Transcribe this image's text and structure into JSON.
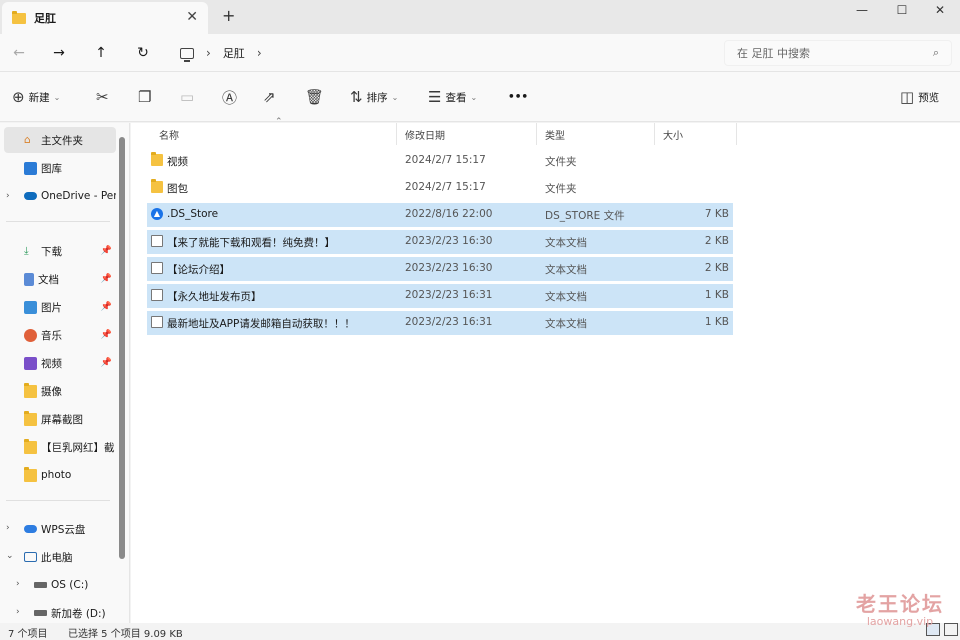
{
  "window": {
    "tab_title": "足肛",
    "tab_close": "✕",
    "tab_add": "+",
    "minimize": "—",
    "maximize": "☐",
    "close": "✕"
  },
  "address": {
    "crumb": "足肛",
    "search_placeholder": "在 足肛 中搜索"
  },
  "toolbar": {
    "new_label": "新建",
    "sort_label": "排序",
    "view_label": "查看",
    "more_label": "•••",
    "preview_label": "预览"
  },
  "sidebar": {
    "items": [
      {
        "label": "主文件夹",
        "icon": "home-icon"
      },
      {
        "label": "图库",
        "icon": "gallery-icon"
      },
      {
        "label": "OneDrive - Per",
        "icon": "cloud-icon"
      },
      {
        "label": "下载",
        "icon": "download-icon"
      },
      {
        "label": "文档",
        "icon": "document-icon"
      },
      {
        "label": "图片",
        "icon": "picture-icon"
      },
      {
        "label": "音乐",
        "icon": "music-icon"
      },
      {
        "label": "视频",
        "icon": "video-icon"
      },
      {
        "label": "摄像",
        "icon": "folder-icon"
      },
      {
        "label": "屏幕截图",
        "icon": "folder-icon"
      },
      {
        "label": "【巨乳网红】截",
        "icon": "folder-icon"
      },
      {
        "label": "photo",
        "icon": "folder-icon"
      },
      {
        "label": "WPS云盘",
        "icon": "wps-cloud-icon"
      },
      {
        "label": "此电脑",
        "icon": "pc-icon"
      },
      {
        "label": "OS (C:)",
        "icon": "drive-icon"
      },
      {
        "label": "新加卷 (D:)",
        "icon": "drive-icon"
      }
    ]
  },
  "columns": {
    "name": "名称",
    "modified": "修改日期",
    "type": "类型",
    "size": "大小"
  },
  "files": [
    {
      "name": "视频",
      "date": "2024/2/7 15:17",
      "type": "文件夹",
      "size": "",
      "icon": "folder-icon",
      "selected": false
    },
    {
      "name": "图包",
      "date": "2024/2/7 15:17",
      "type": "文件夹",
      "size": "",
      "icon": "folder-icon",
      "selected": false
    },
    {
      "name": ".DS_Store",
      "date": "2022/8/16 22:00",
      "type": "DS_STORE 文件",
      "size": "7 KB",
      "icon": "app-file-icon",
      "selected": true
    },
    {
      "name": "【来了就能下载和观看！纯免费！】",
      "date": "2023/2/23 16:30",
      "type": "文本文档",
      "size": "2 KB",
      "icon": "text-file-icon",
      "selected": true
    },
    {
      "name": "【论坛介绍】",
      "date": "2023/2/23 16:30",
      "type": "文本文档",
      "size": "2 KB",
      "icon": "text-file-icon",
      "selected": true
    },
    {
      "name": "【永久地址发布页】",
      "date": "2023/2/23 16:31",
      "type": "文本文档",
      "size": "1 KB",
      "icon": "text-file-icon",
      "selected": true
    },
    {
      "name": "最新地址及APP请发邮箱自动获取！！！",
      "date": "2023/2/23 16:31",
      "type": "文本文档",
      "size": "1 KB",
      "icon": "text-file-icon",
      "selected": true
    }
  ],
  "status": {
    "count": "7 个项目",
    "selection": "已选择 5 个项目  9.09 KB"
  },
  "watermark": {
    "line1": "老王论坛",
    "line2": "laowang.vip"
  },
  "colors": {
    "selection": "#cce4f7",
    "folder": "#f5c241",
    "accent": "#1a73e8"
  }
}
